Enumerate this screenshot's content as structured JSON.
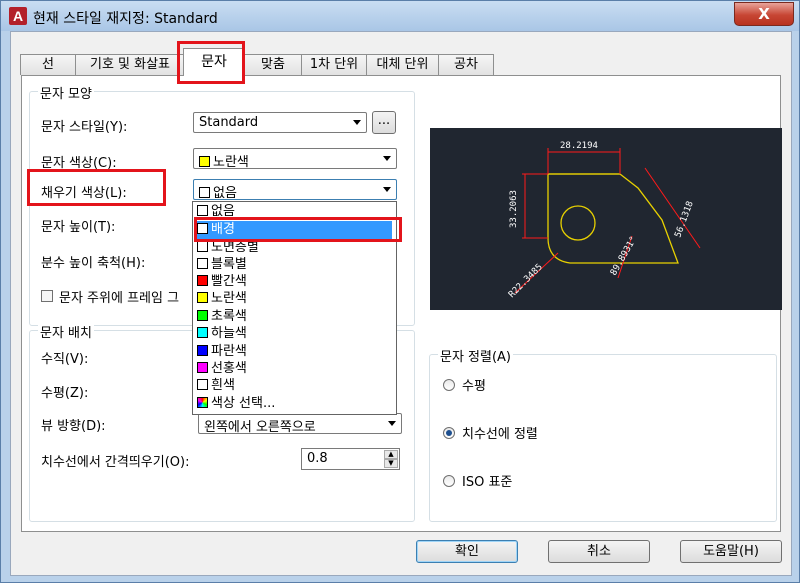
{
  "window": {
    "title": "현재 스타일 재지정: Standard",
    "close_label": "X"
  },
  "tabs": [
    {
      "label": "선"
    },
    {
      "label": "기호 및 화살표"
    },
    {
      "label": "문자"
    },
    {
      "label": "맞춤"
    },
    {
      "label": "1차 단위"
    },
    {
      "label": "대체 단위"
    },
    {
      "label": "공차"
    }
  ],
  "text_appearance": {
    "group_title": "문자 모양",
    "style_label": "문자 스타일(Y):",
    "style_value": "Standard",
    "style_browse": "...",
    "color_label": "문자 색상(C):",
    "color_value": "노란색",
    "color_swatch": "#ffff00",
    "fill_label": "채우기 색상(L):",
    "fill_value": "없음",
    "height_label": "문자 높이(T):",
    "fraction_label": "분수 높이 축척(H):",
    "frame_label": "문자 주위에 프레임 그"
  },
  "fill_dropdown": {
    "items": [
      {
        "label": "없음",
        "color": "#ffffff"
      },
      {
        "label": "배경",
        "color": "#ffffff",
        "selected": true
      },
      {
        "label": "도면층별",
        "color": "#ffffff"
      },
      {
        "label": "블록별",
        "color": "#ffffff"
      },
      {
        "label": "빨간색",
        "color": "#ff0000"
      },
      {
        "label": "노란색",
        "color": "#ffff00"
      },
      {
        "label": "초록색",
        "color": "#00ff00"
      },
      {
        "label": "하늘색",
        "color": "#00ffff"
      },
      {
        "label": "파란색",
        "color": "#0000ff"
      },
      {
        "label": "선홍색",
        "color": "#ff00ff"
      },
      {
        "label": "흰색",
        "color": "#ffffff"
      },
      {
        "label": "색상 선택...",
        "color": "#multicolor"
      }
    ]
  },
  "text_placement": {
    "group_title": "문자 배치",
    "vertical_label": "수직(V):",
    "horizontal_label": "수평(Z):",
    "view_label": "뷰 방향(D):",
    "view_value": "왼쪽에서 오른쪽으로",
    "offset_label": "치수선에서 간격띄우기(O):",
    "offset_value": "0.8"
  },
  "text_alignment": {
    "group_title": "문자 정렬(A)",
    "options": [
      {
        "label": "수평",
        "checked": false
      },
      {
        "label": "치수선에 정렬",
        "checked": true
      },
      {
        "label": "ISO 표준",
        "checked": false
      }
    ]
  },
  "preview": {
    "dim_top": "28.2194",
    "dim_left": "33.2063",
    "dim_right": "56.1318",
    "dim_angle": "89.8931°",
    "dim_radius": "R22.3485"
  },
  "buttons": {
    "ok": "확인",
    "cancel": "취소",
    "help": "도움말(H)"
  },
  "colors": {
    "highlight": "#e3141b",
    "selection": "#3399ff",
    "preview_bg": "#202630",
    "preview_line": "#e8d100",
    "preview_dim": "#ff1a1a"
  }
}
